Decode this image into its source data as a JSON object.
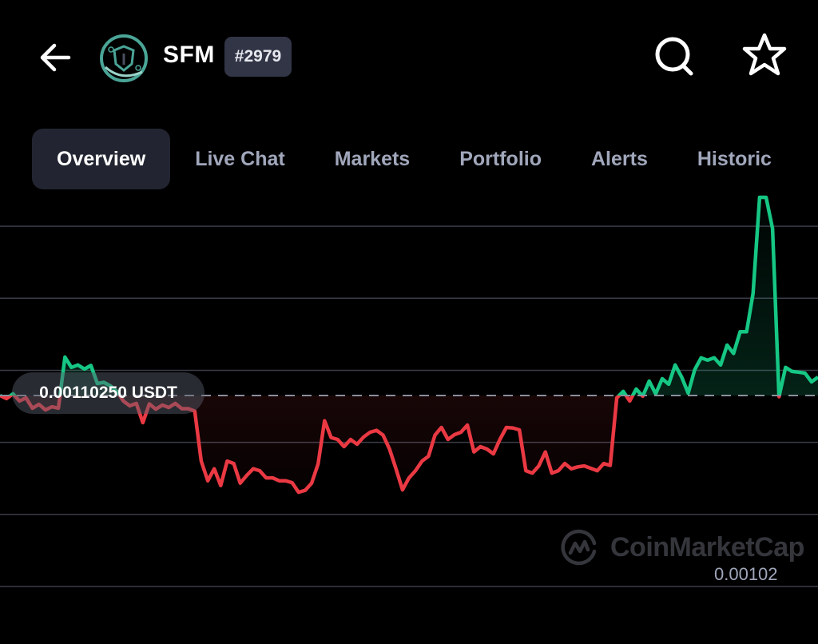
{
  "header": {
    "back_icon": "arrow-left-icon",
    "coin_logo": "safemoon-shield-logo",
    "ticker": "SFM",
    "rank": "#2979",
    "search_icon": "search-icon",
    "favorite_icon": "star-outline-icon"
  },
  "tabs": [
    {
      "label": "Overview",
      "active": true
    },
    {
      "label": "Live Chat",
      "active": false
    },
    {
      "label": "Markets",
      "active": false
    },
    {
      "label": "Portfolio",
      "active": false
    },
    {
      "label": "Alerts",
      "active": false
    },
    {
      "label": "Historic",
      "active": false
    }
  ],
  "colors": {
    "up": "#16c784",
    "down": "#ea3943",
    "grid": "#2b2e38",
    "tab_active_bg": "#222531",
    "tab_text": "#a1a7bb",
    "rank_bg": "#323546"
  },
  "chart": {
    "reference_label": "0.00110250 USDT",
    "min_label": "0.00102",
    "watermark": "CoinMarketCap"
  },
  "chart_data": {
    "type": "line",
    "title": "",
    "xlabel": "",
    "ylabel": "",
    "currency": "USDT",
    "reference_price": 0.0011025,
    "ylim": [
      0.00102,
      0.001182
    ],
    "grid": true,
    "gridline_values": [
      0.001173,
      0.001143,
      0.001113,
      0.001083,
      0.001053,
      0.001023
    ],
    "color_rule": "green above reference price, red below",
    "series": [
      {
        "name": "SFM/USDT",
        "values": [
          0.0011025,
          0.0011012,
          0.0011032,
          0.0011002,
          0.0011015,
          0.0010972,
          0.0010988,
          0.0010965,
          0.0010978,
          0.0010972,
          0.0011185,
          0.0011142,
          0.0011152,
          0.0011135,
          0.001115,
          0.0011075,
          0.001108,
          0.0011065,
          0.0011042,
          0.0011002,
          0.0010982,
          0.0010992,
          0.0010912,
          0.001099,
          0.0010968,
          0.0010985,
          0.0010975,
          0.0010992,
          0.001097,
          0.001097,
          0.001096,
          0.0010752,
          0.001067,
          0.001072,
          0.001065,
          0.0010752,
          0.0010742,
          0.001066,
          0.0010692,
          0.001072,
          0.0010712,
          0.0010682,
          0.0010682,
          0.001067,
          0.001067,
          0.0010662,
          0.0010622,
          0.001063,
          0.001066,
          0.001074,
          0.001092,
          0.001085,
          0.0010842,
          0.0010812,
          0.0010842,
          0.0010822,
          0.0010852,
          0.0010872,
          0.001088,
          0.001086,
          0.0010802,
          0.001072,
          0.0010632,
          0.0010682,
          0.0010712,
          0.0010752,
          0.0010772,
          0.001086,
          0.0010892,
          0.0010842,
          0.0010862,
          0.0010872,
          0.0010902,
          0.001079,
          0.0010812,
          0.0010802,
          0.0010782,
          0.0010842,
          0.0010892,
          0.001089,
          0.0010882,
          0.0010712,
          0.0010702,
          0.0010732,
          0.001079,
          0.0010702,
          0.0010712,
          0.0010742,
          0.001072,
          0.0010728,
          0.0010732,
          0.0010722,
          0.0010712,
          0.0010742,
          0.0010734,
          0.0011015,
          0.0011042,
          0.0011002,
          0.0011052,
          0.0011022,
          0.0011085,
          0.0011032,
          0.0011095,
          0.0011072,
          0.0011152,
          0.0011102,
          0.0011035,
          0.0011132,
          0.0011182,
          0.0011172,
          0.0011182,
          0.0011152,
          0.0011235,
          0.00112,
          0.001129,
          0.001129,
          0.001145,
          0.001185,
          0.001185,
          0.001172,
          0.001102,
          0.0011142,
          0.0011125,
          0.0011122,
          0.0011118,
          0.0011082,
          0.0011102
        ]
      }
    ]
  }
}
